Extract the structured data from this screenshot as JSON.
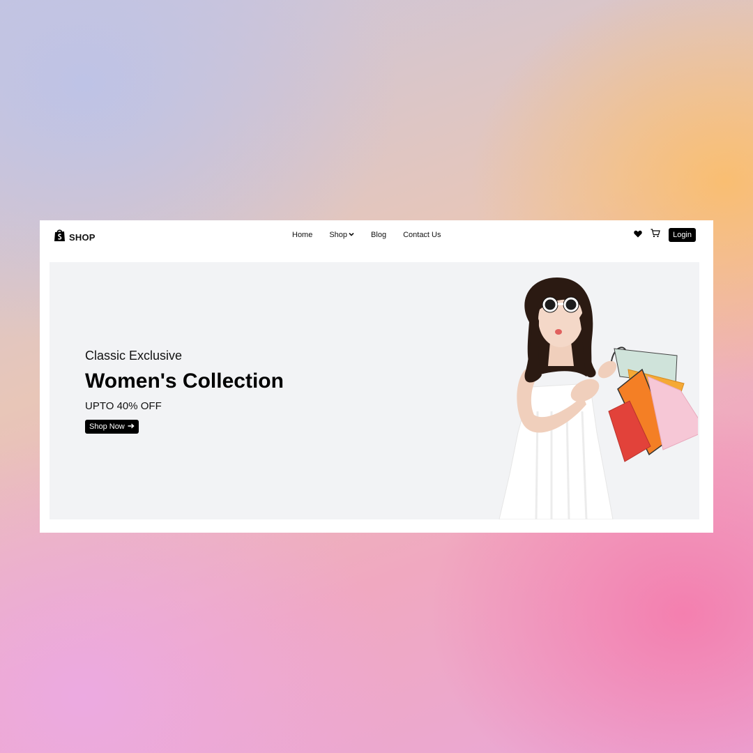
{
  "brand": {
    "name": "SHOP",
    "icon": "shopping-bag-icon"
  },
  "nav": {
    "items": [
      "Home",
      "Shop",
      "Blog",
      "Contact Us"
    ],
    "shop_dropdown_icon": "chevron-down-icon"
  },
  "actions": {
    "wishlist_icon": "heart-icon",
    "cart_icon": "cart-icon",
    "login_label": "Login"
  },
  "hero": {
    "eyebrow": "Classic Exclusive",
    "headline": "Women's Collection",
    "offer": "UPTO 40% OFF",
    "cta_label": "Shop Now",
    "cta_icon": "arrow-right-icon",
    "background": "#f2f3f5"
  },
  "colors": {
    "accent": "#000000",
    "card": "#ffffff"
  }
}
